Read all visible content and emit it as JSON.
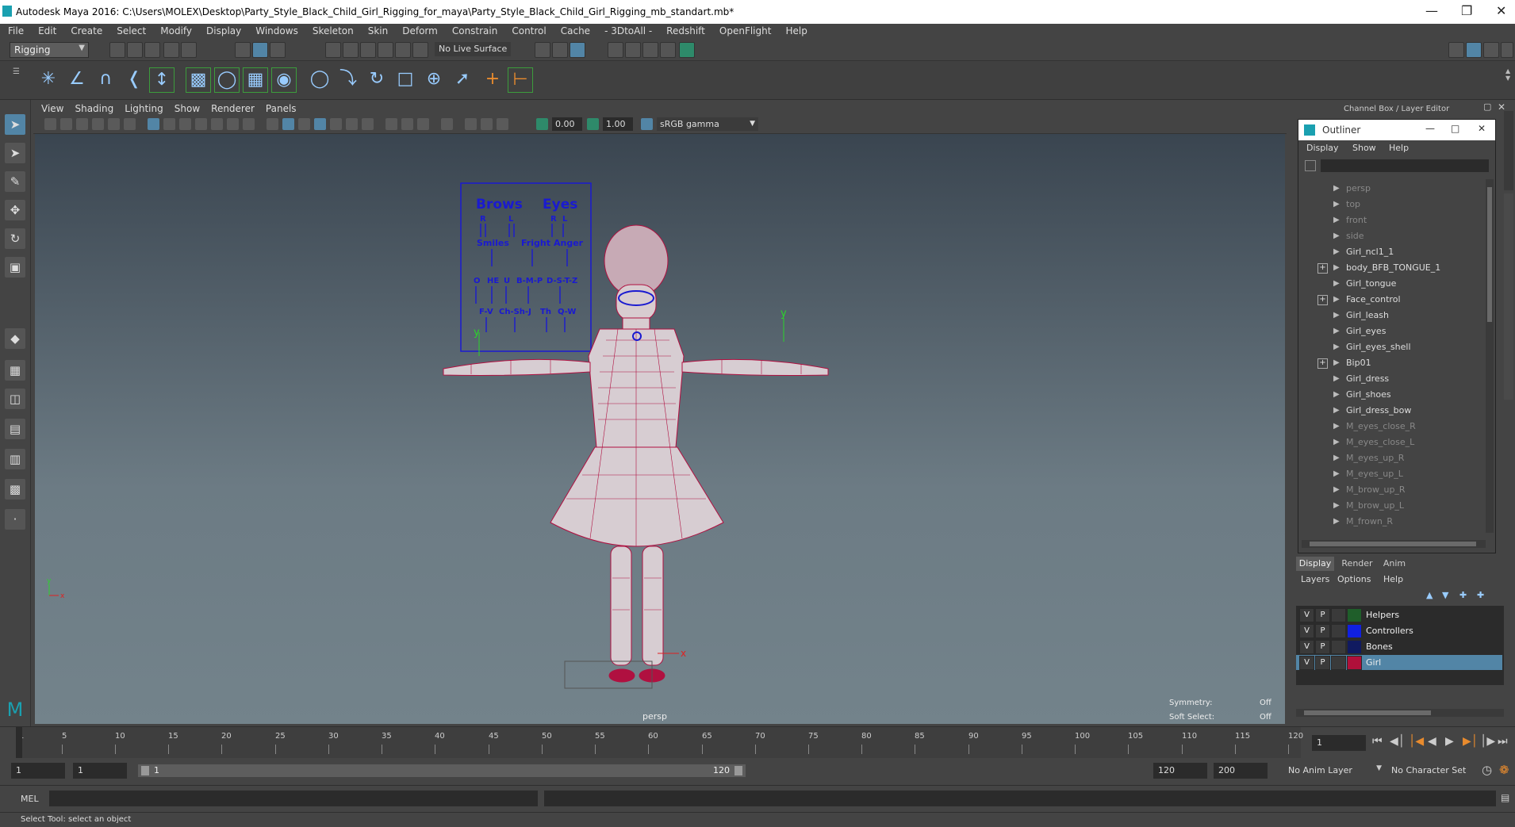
{
  "window": {
    "title": "Autodesk Maya 2016: C:\\Users\\MOLEX\\Desktop\\Party_Style_Black_Child_Girl_Rigging_for_maya\\Party_Style_Black_Child_Girl_Rigging_mb_standart.mb*"
  },
  "menubar": [
    "File",
    "Edit",
    "Create",
    "Select",
    "Modify",
    "Display",
    "Windows",
    "Skeleton",
    "Skin",
    "Deform",
    "Constrain",
    "Control",
    "Cache",
    "- 3DtoAll -",
    "Redshift",
    "OpenFlight",
    "Help"
  ],
  "status": {
    "menuset": "Rigging",
    "live_surface": "No Live Surface"
  },
  "viewport": {
    "menu": [
      "View",
      "Shading",
      "Lighting",
      "Show",
      "Renderer",
      "Panels"
    ],
    "near_value": "0.00",
    "far_value": "1.00",
    "color_space": "sRGB gamma",
    "camera_label": "persp",
    "symmetry_label": "Symmetry:",
    "symmetry_value": "Off",
    "soft_select_label": "Soft Select:",
    "soft_select_value": "Off",
    "face_panel": {
      "brows": "Brows",
      "eyes": "Eyes",
      "r1": "R",
      "l1": "L",
      "r2": "R",
      "l2": "L",
      "smiles": "Smiles",
      "fright": "Fright",
      "anger": "Anger",
      "o": "O",
      "he": "HE",
      "u": "U",
      "bmp": "B-M-P",
      "dstz": "D-S-T-Z",
      "fv": "F-V",
      "chshj": "Ch-Sh-J",
      "th": "Th",
      "qw": "Q-W"
    },
    "axis_y": "y",
    "axis_x": "x",
    "axis_z": "z"
  },
  "channel_box_title": "Channel Box / Layer Editor",
  "outliner": {
    "title": "Outliner",
    "menu": [
      "Display",
      "Show",
      "Help"
    ],
    "items": [
      {
        "label": "persp",
        "dim": true,
        "plus": false
      },
      {
        "label": "top",
        "dim": true,
        "plus": false
      },
      {
        "label": "front",
        "dim": true,
        "plus": false
      },
      {
        "label": "side",
        "dim": true,
        "plus": false
      },
      {
        "label": "Girl_ncl1_1",
        "dim": false,
        "plus": false
      },
      {
        "label": "body_BFB_TONGUE_1",
        "dim": false,
        "plus": true
      },
      {
        "label": "Girl_tongue",
        "dim": false,
        "plus": false
      },
      {
        "label": "Face_control",
        "dim": false,
        "plus": true
      },
      {
        "label": "Girl_leash",
        "dim": false,
        "plus": false
      },
      {
        "label": "Girl_eyes",
        "dim": false,
        "plus": false
      },
      {
        "label": "Girl_eyes_shell",
        "dim": false,
        "plus": false
      },
      {
        "label": "Bip01",
        "dim": false,
        "plus": true
      },
      {
        "label": "Girl_dress",
        "dim": false,
        "plus": false
      },
      {
        "label": "Girl_shoes",
        "dim": false,
        "plus": false
      },
      {
        "label": "Girl_dress_bow",
        "dim": false,
        "plus": false
      },
      {
        "label": "M_eyes_close_R",
        "dim": true,
        "plus": false
      },
      {
        "label": "M_eyes_close_L",
        "dim": true,
        "plus": false
      },
      {
        "label": "M_eyes_up_R",
        "dim": true,
        "plus": false
      },
      {
        "label": "M_eyes_up_L",
        "dim": true,
        "plus": false
      },
      {
        "label": "M_brow_up_R",
        "dim": true,
        "plus": false
      },
      {
        "label": "M_brow_up_L",
        "dim": true,
        "plus": false
      },
      {
        "label": "M_frown_R",
        "dim": true,
        "plus": false
      }
    ]
  },
  "layer_editor": {
    "tabs": [
      "Display",
      "Render",
      "Anim"
    ],
    "menu": [
      "Layers",
      "Options",
      "Help"
    ],
    "layers": [
      {
        "v": "V",
        "p": "P",
        "name": "Helpers",
        "color": "#1f5e2a"
      },
      {
        "v": "V",
        "p": "P",
        "name": "Controllers",
        "color": "#1020e0"
      },
      {
        "v": "V",
        "p": "P",
        "name": "Bones",
        "color": "#101a60"
      },
      {
        "v": "V",
        "p": "P",
        "name": "Girl",
        "color": "#b0103a"
      }
    ]
  },
  "timeline": {
    "ticks": [
      "1",
      "5",
      "10",
      "15",
      "20",
      "25",
      "30",
      "35",
      "40",
      "45",
      "50",
      "55",
      "60",
      "65",
      "70",
      "75",
      "80",
      "85",
      "90",
      "95",
      "100",
      "105",
      "110",
      "115",
      "120"
    ],
    "current_frame": "1"
  },
  "range": {
    "start": "1",
    "inner_start": "1",
    "slider_start": "1",
    "slider_end": "120",
    "end": "120",
    "outer_end": "200",
    "anim_layer": "No Anim Layer",
    "character_set": "No Character Set"
  },
  "command": {
    "label": "MEL"
  },
  "help_text": "Select Tool: select an object",
  "colors": {
    "accent": "#5285a6",
    "mesh": "#b01040",
    "controls": "#1a1ad0"
  }
}
